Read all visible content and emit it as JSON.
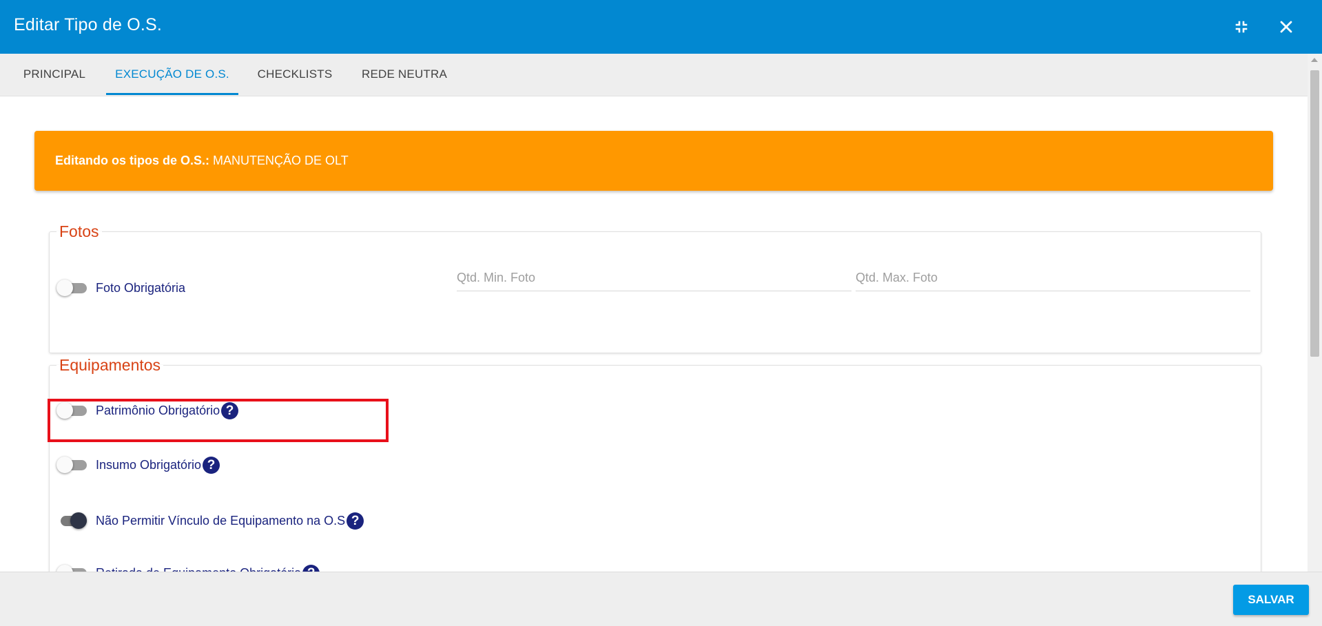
{
  "dialog": {
    "title": "Editar Tipo de O.S.",
    "minimize_icon": "compress-icon",
    "close_icon": "close-icon"
  },
  "tabs": [
    {
      "label": "PRINCIPAL",
      "active": false
    },
    {
      "label": "EXECUÇÃO DE O.S.",
      "active": true
    },
    {
      "label": "CHECKLISTS",
      "active": false
    },
    {
      "label": "REDE NEUTRA",
      "active": false
    }
  ],
  "banner": {
    "prefix": "Editando os tipos de O.S.:",
    "value": "MANUTENÇÃO DE OLT"
  },
  "fotos": {
    "legend": "Fotos",
    "toggle_label": "Foto Obrigatória",
    "toggle_on": false,
    "min_placeholder": "Qtd. Min. Foto",
    "min_value": "",
    "max_placeholder": "Qtd. Max. Foto",
    "max_value": ""
  },
  "equipamentos": {
    "legend": "Equipamentos",
    "items": [
      {
        "label": "Patrimônio Obrigatório",
        "on": false,
        "help": "?"
      },
      {
        "label": "Insumo Obrigatório",
        "on": false,
        "help": "?"
      },
      {
        "label": "Não Permitir Vínculo de Equipamento na O.S",
        "on": true,
        "help": "?"
      },
      {
        "label": "Retirada de Equipamento Obrigatória",
        "on": false,
        "help": "?"
      }
    ]
  },
  "footer": {
    "save_label": "SALVAR"
  },
  "colors": {
    "header": "#0288d1",
    "banner": "#ff9800",
    "legend": "#d84315",
    "label": "#1a237e",
    "highlight": "#e8101a"
  }
}
